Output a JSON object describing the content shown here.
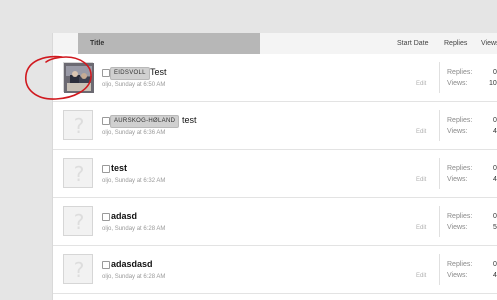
{
  "header": {
    "title": "Title",
    "start_date": "Start Date",
    "replies": "Replies",
    "views": "Views"
  },
  "threads": [
    {
      "prefix": "EIDSVOLL",
      "title": "Test",
      "author": "oljo",
      "time": "Sunday at 6:50 AM",
      "edit": "Edit",
      "replies_label": "Replies:",
      "replies": "0",
      "views_label": "Views:",
      "views": "10"
    },
    {
      "prefix": "AURSKOG-HØLAND",
      "title": "test",
      "author": "oljo",
      "time": "Sunday at 6:36 AM",
      "edit": "Edit",
      "replies_label": "Replies:",
      "replies": "0",
      "views_label": "Views:",
      "views": "4"
    },
    {
      "prefix": "",
      "title": "test",
      "author": "oljo",
      "time": "Sunday at 6:32 AM",
      "edit": "Edit",
      "replies_label": "Replies:",
      "replies": "0",
      "views_label": "Views:",
      "views": "4"
    },
    {
      "prefix": "",
      "title": "adasd",
      "author": "oljo",
      "time": "Sunday at 6:28 AM",
      "edit": "Edit",
      "replies_label": "Replies:",
      "replies": "0",
      "views_label": "Views:",
      "views": "5"
    },
    {
      "prefix": "",
      "title": "adasdasd",
      "author": "oljo",
      "time": "Sunday at 6:28 AM",
      "edit": "Edit",
      "replies_label": "Replies:",
      "replies": "0",
      "views_label": "Views:",
      "views": "4"
    }
  ],
  "icons": {
    "avatar_photo": "avatar-photo-icon",
    "avatar_placeholder": "question-mark-avatar-icon"
  },
  "colors": {
    "annotation": "#d0191f",
    "title_header": "#b7b7b7",
    "prefix_bg": "#d0d0d0"
  }
}
